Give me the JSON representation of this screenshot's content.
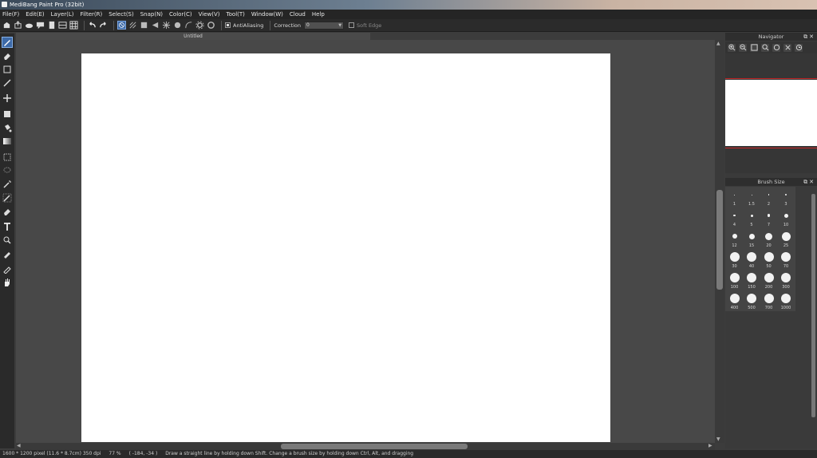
{
  "window": {
    "title": "MediBang Paint Pro (32bit)"
  },
  "menu": [
    {
      "label": "File(F)"
    },
    {
      "label": "Edit(E)"
    },
    {
      "label": "Layer(L)"
    },
    {
      "label": "Filter(R)"
    },
    {
      "label": "Select(S)"
    },
    {
      "label": "Snap(N)"
    },
    {
      "label": "Color(C)"
    },
    {
      "label": "View(V)"
    },
    {
      "label": "Tool(T)"
    },
    {
      "label": "Window(W)"
    },
    {
      "label": "Cloud"
    },
    {
      "label": "Help"
    }
  ],
  "toolbar": {
    "antialiasing_label": "AntiAliasing",
    "antialiasing_checked": true,
    "correction_label": "Correction",
    "correction_value": "0",
    "soft_edge_label": "Soft Edge",
    "soft_edge_checked": false
  },
  "document": {
    "tab_title": "Untitled"
  },
  "panels": {
    "navigator_title": "Navigator",
    "brush_size_title": "Brush Size"
  },
  "brush_sizes": [
    "1",
    "1.5",
    "2",
    "3",
    "4",
    "5",
    "7",
    "10",
    "12",
    "15",
    "20",
    "25",
    "30",
    "40",
    "50",
    "70",
    "100",
    "150",
    "200",
    "300",
    "400",
    "500",
    "700",
    "1000"
  ],
  "status": {
    "canvas_size": "1600 * 1200 pixel   (11.6 * 8.7cm)   350 dpi",
    "zoom": "77 %",
    "cursor": "( -184, -34 )",
    "hint": "Draw a straight line by holding down Shift. Change a brush size by holding down Ctrl, Alt, and dragging"
  },
  "colors": {
    "accent": "#3d6aa8",
    "panel": "#3a3a3a",
    "canvas_bg": "#484848",
    "nav_frame": "#c62828"
  }
}
